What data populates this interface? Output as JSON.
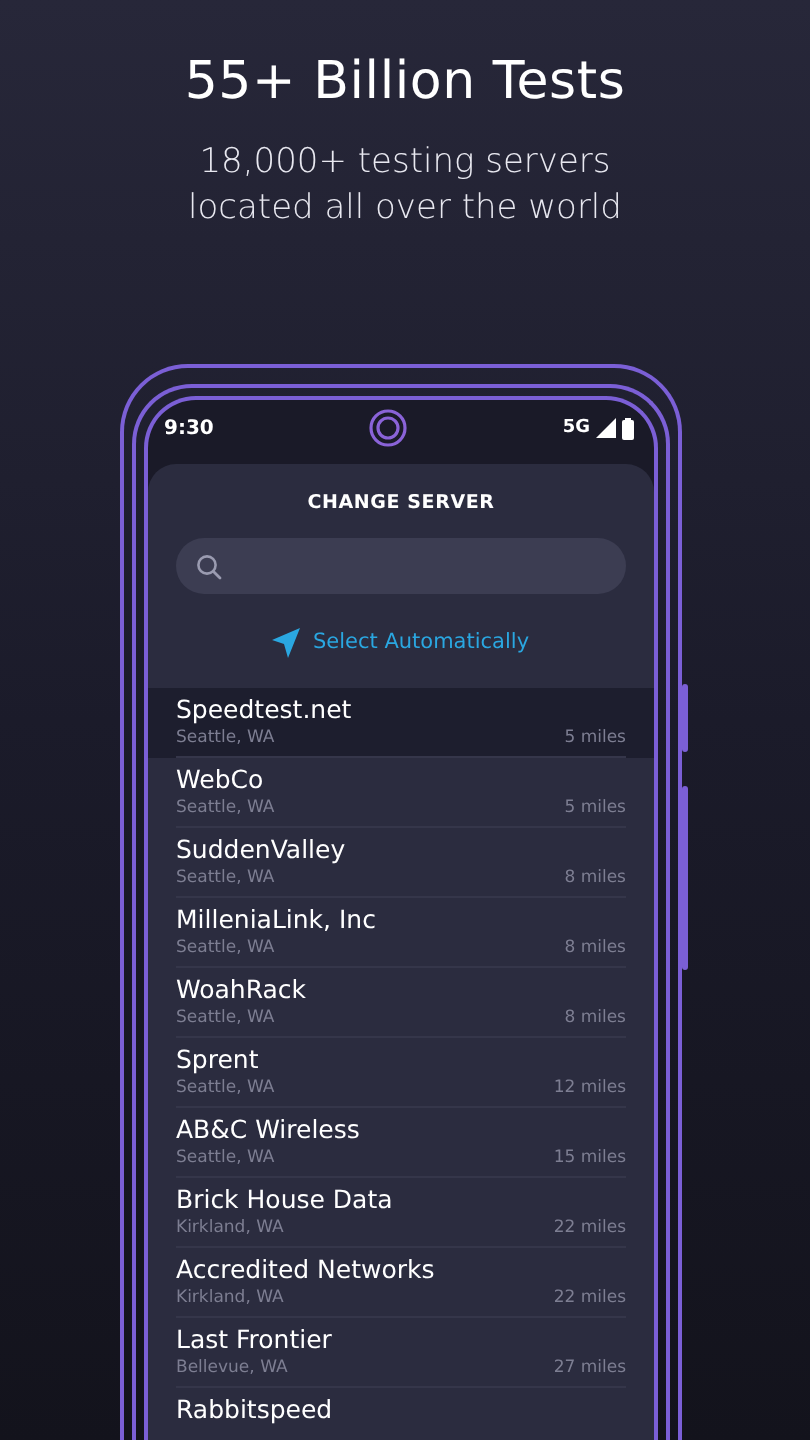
{
  "headline": "55+ Billion Tests",
  "subheadline": "18,000+ testing servers located all over the world",
  "status_bar": {
    "time": "9:30",
    "network": "5G"
  },
  "sheet": {
    "title": "CHANGE SERVER",
    "select_automatically": "Select Automatically"
  },
  "servers": [
    {
      "name": "Speedtest.net",
      "location": "Seattle, WA",
      "distance": "5 miles",
      "selected": true
    },
    {
      "name": "WebCo",
      "location": "Seattle, WA",
      "distance": "5 miles",
      "selected": false
    },
    {
      "name": "SuddenValley",
      "location": "Seattle, WA",
      "distance": "8 miles",
      "selected": false
    },
    {
      "name": "MilleniaLink, Inc",
      "location": "Seattle, WA",
      "distance": "8 miles",
      "selected": false
    },
    {
      "name": "WoahRack",
      "location": "Seattle, WA",
      "distance": "8 miles",
      "selected": false
    },
    {
      "name": "Sprent",
      "location": "Seattle, WA",
      "distance": "12 miles",
      "selected": false
    },
    {
      "name": "AB&C Wireless",
      "location": "Seattle, WA",
      "distance": "15 miles",
      "selected": false
    },
    {
      "name": "Brick House Data",
      "location": "Kirkland, WA",
      "distance": "22 miles",
      "selected": false
    },
    {
      "name": "Accredited Networks",
      "location": "Kirkland, WA",
      "distance": "22 miles",
      "selected": false
    },
    {
      "name": "Last Frontier",
      "location": "Bellevue, WA",
      "distance": "27 miles",
      "selected": false
    },
    {
      "name": "Rabbitspeed",
      "selected": false
    }
  ]
}
